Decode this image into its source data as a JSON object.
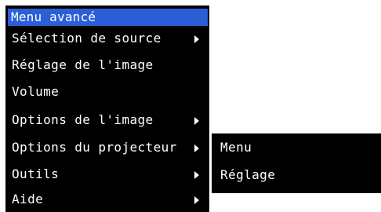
{
  "menu": {
    "title": "Menu avancé",
    "items": [
      {
        "label": "Sélection de source",
        "has_submenu": true
      },
      {
        "label": "Réglage de l'image",
        "has_submenu": false
      },
      {
        "label": "Volume",
        "has_submenu": false
      },
      {
        "label": "Options de l'image",
        "has_submenu": true
      },
      {
        "label": "Options du projecteur",
        "has_submenu": true
      },
      {
        "label": "Outils",
        "has_submenu": true
      },
      {
        "label": "Aide",
        "has_submenu": true
      }
    ]
  },
  "submenu": {
    "items": [
      {
        "label": "Menu"
      },
      {
        "label": "Réglage"
      }
    ]
  },
  "colors": {
    "menu_background": "#000000",
    "title_highlight": "#2a5fd8",
    "text": "#ffffff",
    "page_background": "#ffffff"
  },
  "icons": {
    "submenu_indicator": "triangle-right-icon"
  }
}
